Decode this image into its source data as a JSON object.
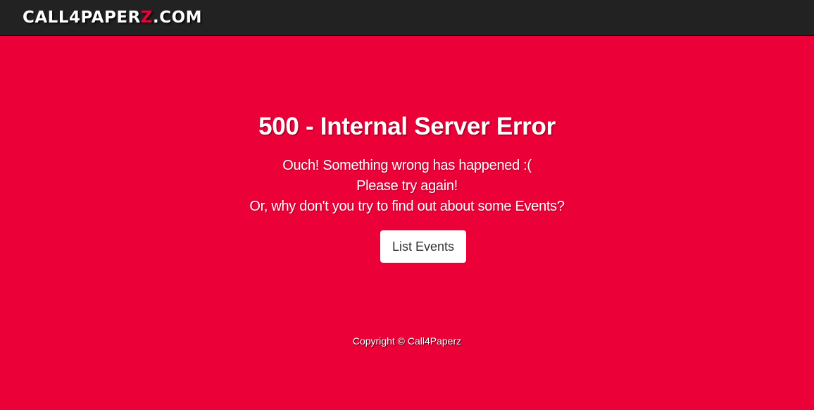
{
  "colors": {
    "background": "#EC0038",
    "navbar": "#222222",
    "brand_accent": "#EC0038",
    "button_bg": "#FFFFFF",
    "button_text": "#333333"
  },
  "navbar": {
    "brand_prefix": "CALL4PAPER",
    "brand_accent": "Z",
    "brand_suffix": ".COM"
  },
  "error": {
    "title": "500 - Internal Server Error",
    "line1": "Ouch! Something wrong has happened :(",
    "line2": "Please try again!",
    "line3": "Or, why don't you try to find out about some Events?",
    "button_label": "List Events"
  },
  "footer": {
    "copyright": "Copyright © Call4Paperz"
  }
}
